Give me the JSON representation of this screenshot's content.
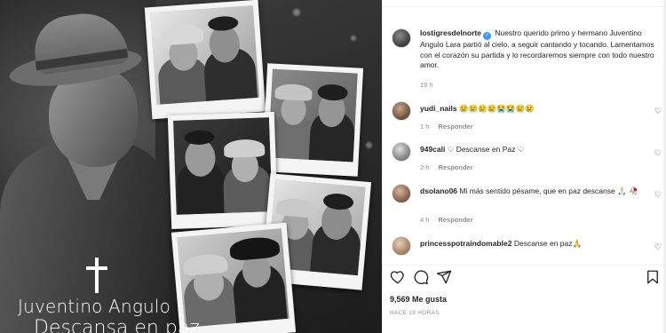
{
  "post_image": {
    "memorial_name": "Juventino Angulo",
    "memorial_subtitle": "Descansa en paz",
    "cross_icon": "latin-cross-icon"
  },
  "header": {
    "username": "lostigresdelnorte"
  },
  "caption": {
    "username": "lostigresdelnorte",
    "text": "Nuestro querido primo y hermano Juventino Angulo Lara partió al cielo, a seguir cantando y tocando. Lamentamos con el corazón su partida y lo recordaremos siempre con todo nuestro amor.",
    "time": "19 h"
  },
  "comments": [
    {
      "username": "yudi_nails",
      "text": "😢😢😢😢😭😭😢😢",
      "time": "1 h",
      "reply": "Responder"
    },
    {
      "username": "949cali",
      "text": "♡ Descanse en Paz ♡",
      "time": "2 h",
      "reply": "Responder"
    },
    {
      "username": "dsolano06",
      "text": "Mi más sentido pésame, que en paz descanse 🙏🏻 🥀",
      "time": "4 h",
      "reply": "Responder"
    },
    {
      "username": "princesspotraindomable2",
      "text": "Descanse en paz🙏",
      "time": "",
      "reply": ""
    }
  ],
  "actions": {
    "like_icon": "heart-icon",
    "comment_icon": "comment-icon",
    "share_icon": "send-icon",
    "save_icon": "bookmark-icon"
  },
  "likes": "9,569 Me gusta",
  "posted": "HACE 19 HORAS"
}
